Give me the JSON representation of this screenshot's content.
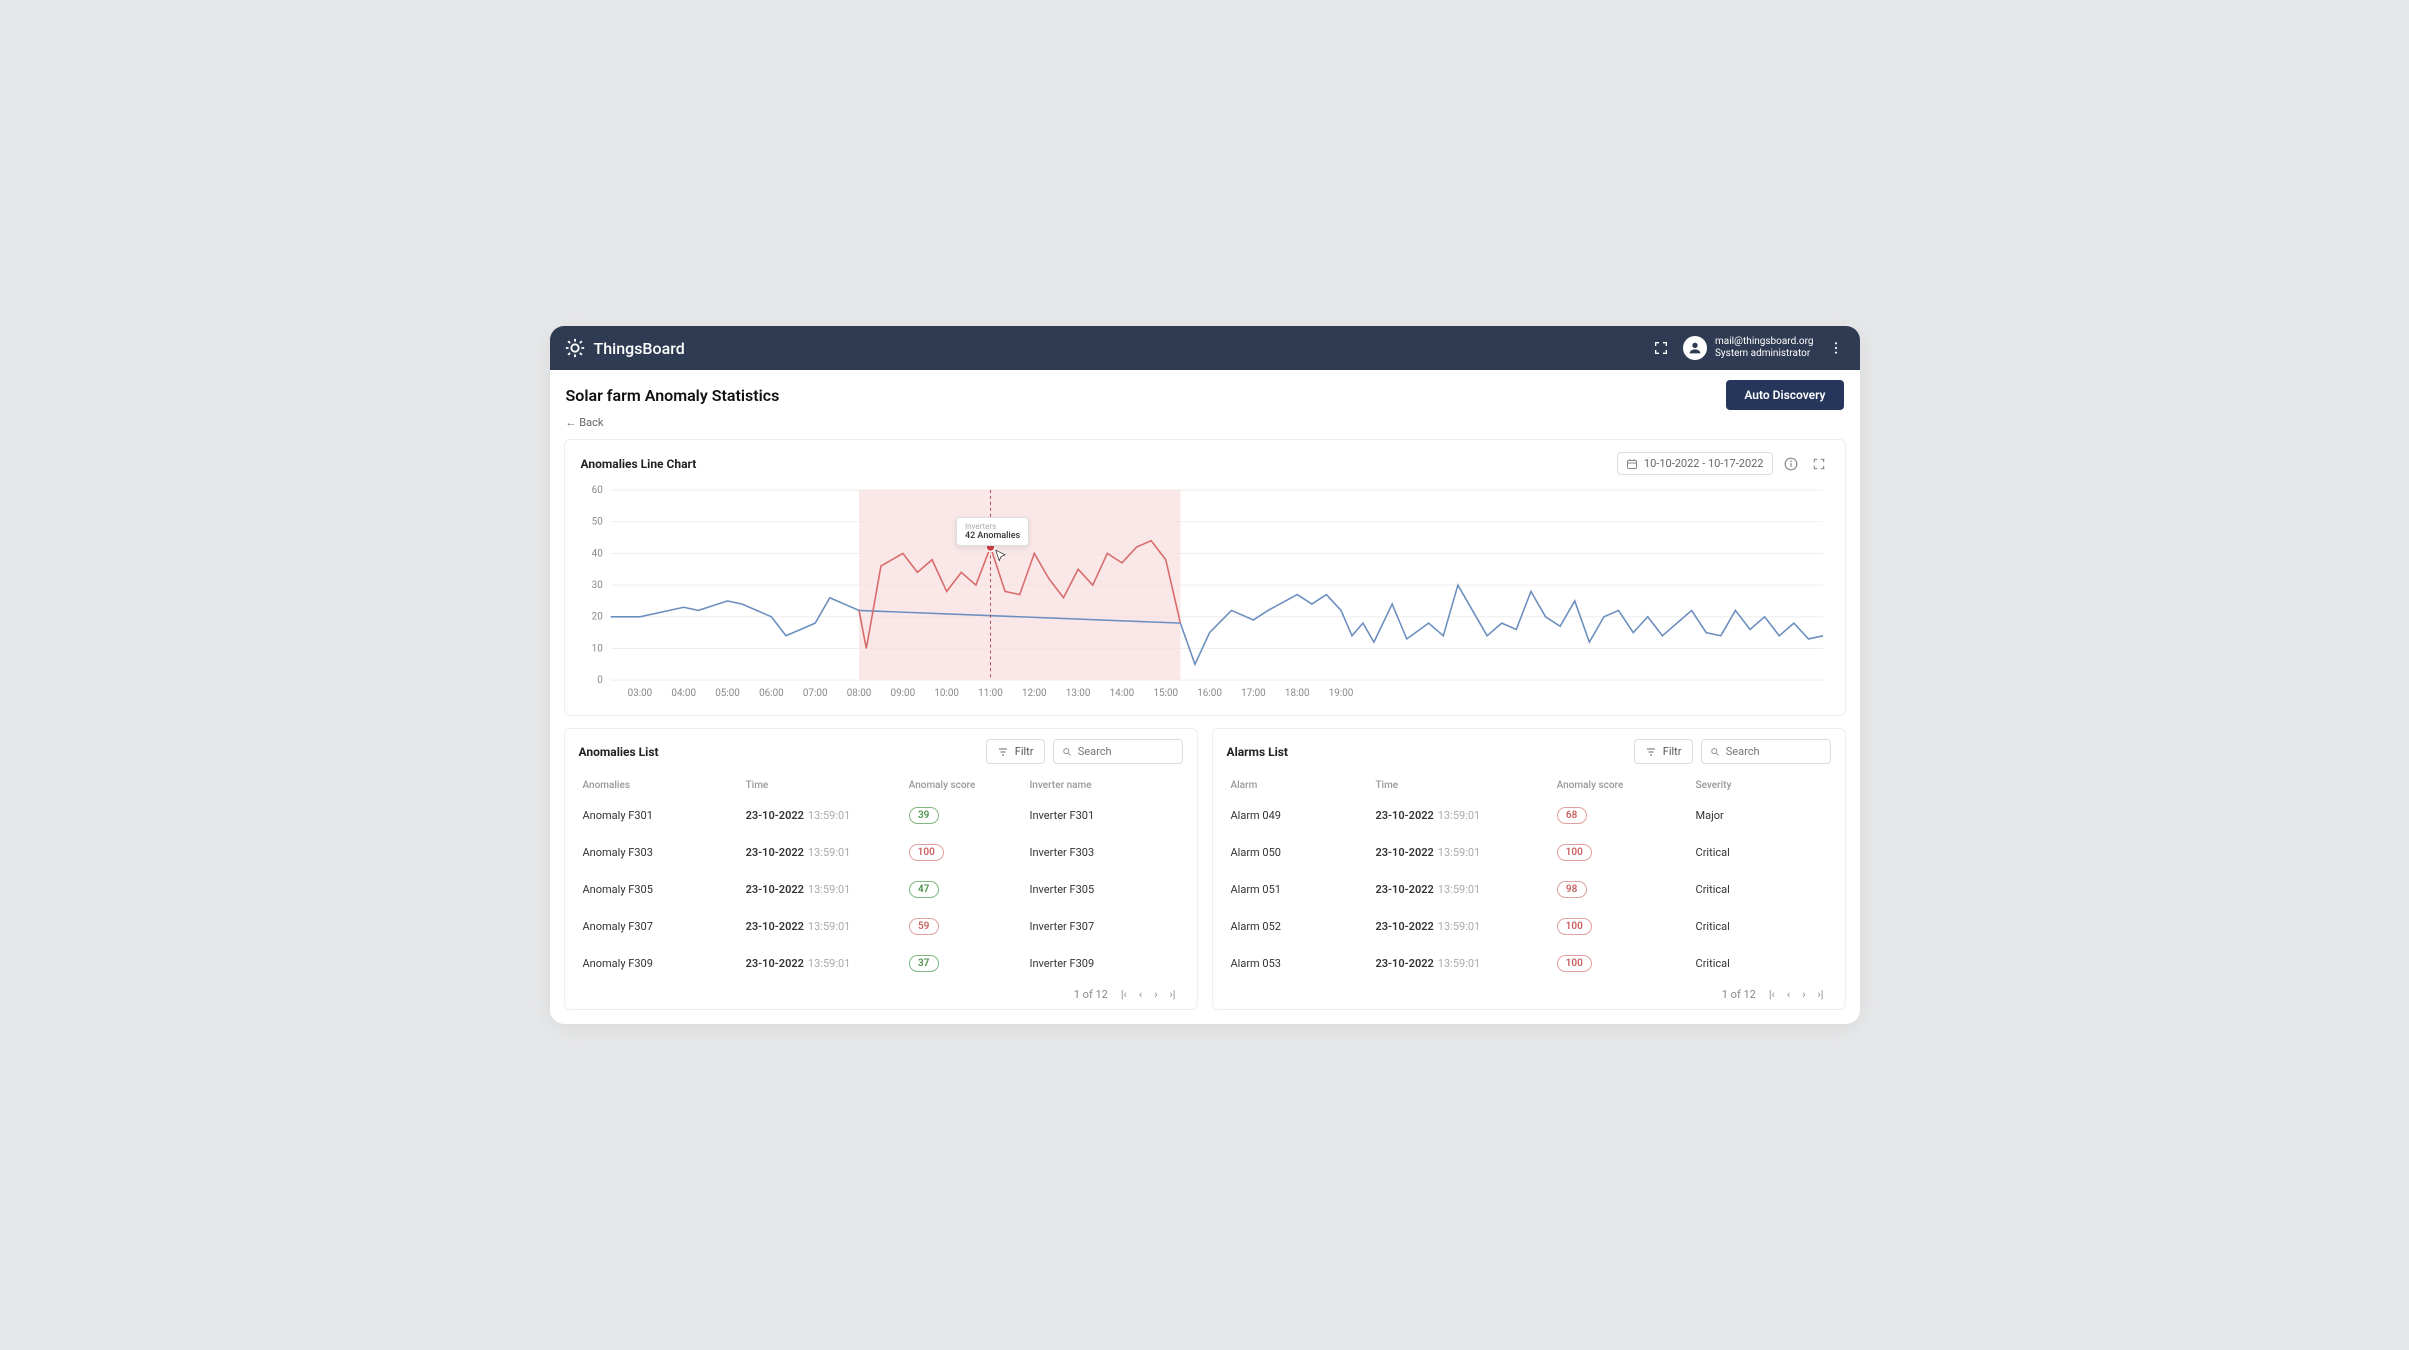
{
  "brand": "ThingsBoard",
  "user": {
    "email": "mail@thingsboard.org",
    "role": "System administrator"
  },
  "page": {
    "title": "Solar farm Anomaly Statistics",
    "back": "←  Back",
    "auto_btn": "Auto Discovery"
  },
  "chart": {
    "title": "Anomalies Line Chart",
    "date_range": "10-10-2022 - 10-17-2022",
    "tooltip": {
      "series": "Inverters",
      "text": "42 Anomalies"
    }
  },
  "chart_data": {
    "type": "line",
    "xlabel": "",
    "ylabel": "",
    "ylim": [
      0,
      60
    ],
    "y_ticks": [
      0,
      10,
      20,
      30,
      40,
      50,
      60
    ],
    "x_ticks": [
      "03:00",
      "04:00",
      "05:00",
      "06:00",
      "07:00",
      "08:00",
      "09:00",
      "10:00",
      "11:00",
      "12:00",
      "13:00",
      "14:00",
      "15:00",
      "16:00",
      "17:00",
      "18:00",
      "19:00"
    ],
    "highlight_band": {
      "from": "08:00",
      "to": "15:20"
    },
    "marker": {
      "x": "11:00",
      "y": 42
    },
    "series": [
      {
        "name": "Inverters (normal)",
        "color": "#6c8fbf",
        "points": [
          {
            "x": "02:20",
            "y": 20
          },
          {
            "x": "03:00",
            "y": 20
          },
          {
            "x": "04:00",
            "y": 23
          },
          {
            "x": "04:20",
            "y": 22
          },
          {
            "x": "05:00",
            "y": 25
          },
          {
            "x": "05:20",
            "y": 24
          },
          {
            "x": "06:00",
            "y": 20
          },
          {
            "x": "06:20",
            "y": 14
          },
          {
            "x": "07:00",
            "y": 18
          },
          {
            "x": "07:20",
            "y": 26
          },
          {
            "x": "08:00",
            "y": 22
          },
          {
            "x": "15:20",
            "y": 18
          },
          {
            "x": "15:40",
            "y": 5
          },
          {
            "x": "16:00",
            "y": 15
          },
          {
            "x": "16:30",
            "y": 22
          },
          {
            "x": "17:00",
            "y": 19
          },
          {
            "x": "17:20",
            "y": 22
          },
          {
            "x": "18:00",
            "y": 27
          },
          {
            "x": "18:20",
            "y": 24
          },
          {
            "x": "18:40",
            "y": 27
          },
          {
            "x": "19:00",
            "y": 22
          },
          {
            "x": "19:15",
            "y": 14
          },
          {
            "x": "19:30",
            "y": 18
          },
          {
            "x": "19:45",
            "y": 12
          },
          {
            "x": "20:10",
            "y": 24
          },
          {
            "x": "20:30",
            "y": 13
          },
          {
            "x": "21:00",
            "y": 18
          },
          {
            "x": "21:20",
            "y": 14
          },
          {
            "x": "21:40",
            "y": 30
          },
          {
            "x": "22:00",
            "y": 22
          },
          {
            "x": "22:20",
            "y": 14
          },
          {
            "x": "22:40",
            "y": 18
          },
          {
            "x": "23:00",
            "y": 16
          },
          {
            "x": "23:20",
            "y": 28
          },
          {
            "x": "23:40",
            "y": 20
          },
          {
            "x": "24:00",
            "y": 17
          },
          {
            "x": "24:20",
            "y": 25
          },
          {
            "x": "24:40",
            "y": 12
          },
          {
            "x": "25:00",
            "y": 20
          },
          {
            "x": "25:20",
            "y": 22
          },
          {
            "x": "25:40",
            "y": 15
          },
          {
            "x": "26:00",
            "y": 20
          },
          {
            "x": "26:20",
            "y": 14
          },
          {
            "x": "26:40",
            "y": 18
          },
          {
            "x": "27:00",
            "y": 22
          },
          {
            "x": "27:20",
            "y": 15
          },
          {
            "x": "27:40",
            "y": 14
          },
          {
            "x": "28:00",
            "y": 22
          },
          {
            "x": "28:20",
            "y": 16
          },
          {
            "x": "28:40",
            "y": 20
          },
          {
            "x": "29:00",
            "y": 14
          },
          {
            "x": "29:20",
            "y": 18
          },
          {
            "x": "29:40",
            "y": 13
          },
          {
            "x": "30:00",
            "y": 14
          }
        ]
      },
      {
        "name": "Inverters (anomaly)",
        "color": "#d86b6b",
        "points": [
          {
            "x": "08:00",
            "y": 22
          },
          {
            "x": "08:10",
            "y": 10
          },
          {
            "x": "08:30",
            "y": 36
          },
          {
            "x": "09:00",
            "y": 40
          },
          {
            "x": "09:20",
            "y": 34
          },
          {
            "x": "09:40",
            "y": 38
          },
          {
            "x": "10:00",
            "y": 28
          },
          {
            "x": "10:20",
            "y": 34
          },
          {
            "x": "10:40",
            "y": 30
          },
          {
            "x": "11:00",
            "y": 42
          },
          {
            "x": "11:20",
            "y": 28
          },
          {
            "x": "11:40",
            "y": 27
          },
          {
            "x": "12:00",
            "y": 40
          },
          {
            "x": "12:20",
            "y": 32
          },
          {
            "x": "12:40",
            "y": 26
          },
          {
            "x": "13:00",
            "y": 35
          },
          {
            "x": "13:20",
            "y": 30
          },
          {
            "x": "13:40",
            "y": 40
          },
          {
            "x": "14:00",
            "y": 37
          },
          {
            "x": "14:20",
            "y": 42
          },
          {
            "x": "14:40",
            "y": 44
          },
          {
            "x": "15:00",
            "y": 38
          },
          {
            "x": "15:20",
            "y": 18
          }
        ]
      }
    ]
  },
  "anomalies": {
    "title": "Anomalies List",
    "filter": "Filtr",
    "search": "Search",
    "cols": [
      "Anomalies",
      "Time",
      "Anomaly score",
      "Inverter name"
    ],
    "rows": [
      {
        "name": "Anomaly F301",
        "date": "23-10-2022",
        "time": "13:59:01",
        "score": 39,
        "score_style": "green",
        "inverter": "Inverter F301"
      },
      {
        "name": "Anomaly F303",
        "date": "23-10-2022",
        "time": "13:59:01",
        "score": 100,
        "score_style": "red",
        "inverter": "Inverter F303"
      },
      {
        "name": "Anomaly F305",
        "date": "23-10-2022",
        "time": "13:59:01",
        "score": 47,
        "score_style": "green",
        "inverter": "Inverter F305"
      },
      {
        "name": "Anomaly F307",
        "date": "23-10-2022",
        "time": "13:59:01",
        "score": 59,
        "score_style": "red",
        "inverter": "Inverter F307"
      },
      {
        "name": "Anomaly F309",
        "date": "23-10-2022",
        "time": "13:59:01",
        "score": 37,
        "score_style": "green",
        "inverter": "Inverter F309"
      }
    ],
    "pager": "1 of 12"
  },
  "alarms": {
    "title": "Alarms List",
    "filter": "Filtr",
    "search": "Search",
    "cols": [
      "Alarm",
      "Time",
      "Anomaly score",
      "Severity"
    ],
    "rows": [
      {
        "name": "Alarm 049",
        "date": "23-10-2022",
        "time": "13:59:01",
        "score": 68,
        "score_style": "red",
        "severity": "Major"
      },
      {
        "name": "Alarm 050",
        "date": "23-10-2022",
        "time": "13:59:01",
        "score": 100,
        "score_style": "red",
        "severity": "Critical"
      },
      {
        "name": "Alarm 051",
        "date": "23-10-2022",
        "time": "13:59:01",
        "score": 98,
        "score_style": "red",
        "severity": "Critical"
      },
      {
        "name": "Alarm 052",
        "date": "23-10-2022",
        "time": "13:59:01",
        "score": 100,
        "score_style": "red",
        "severity": "Critical"
      },
      {
        "name": "Alarm 053",
        "date": "23-10-2022",
        "time": "13:59:01",
        "score": 100,
        "score_style": "red",
        "severity": "Critical"
      }
    ],
    "pager": "1 of 12"
  }
}
